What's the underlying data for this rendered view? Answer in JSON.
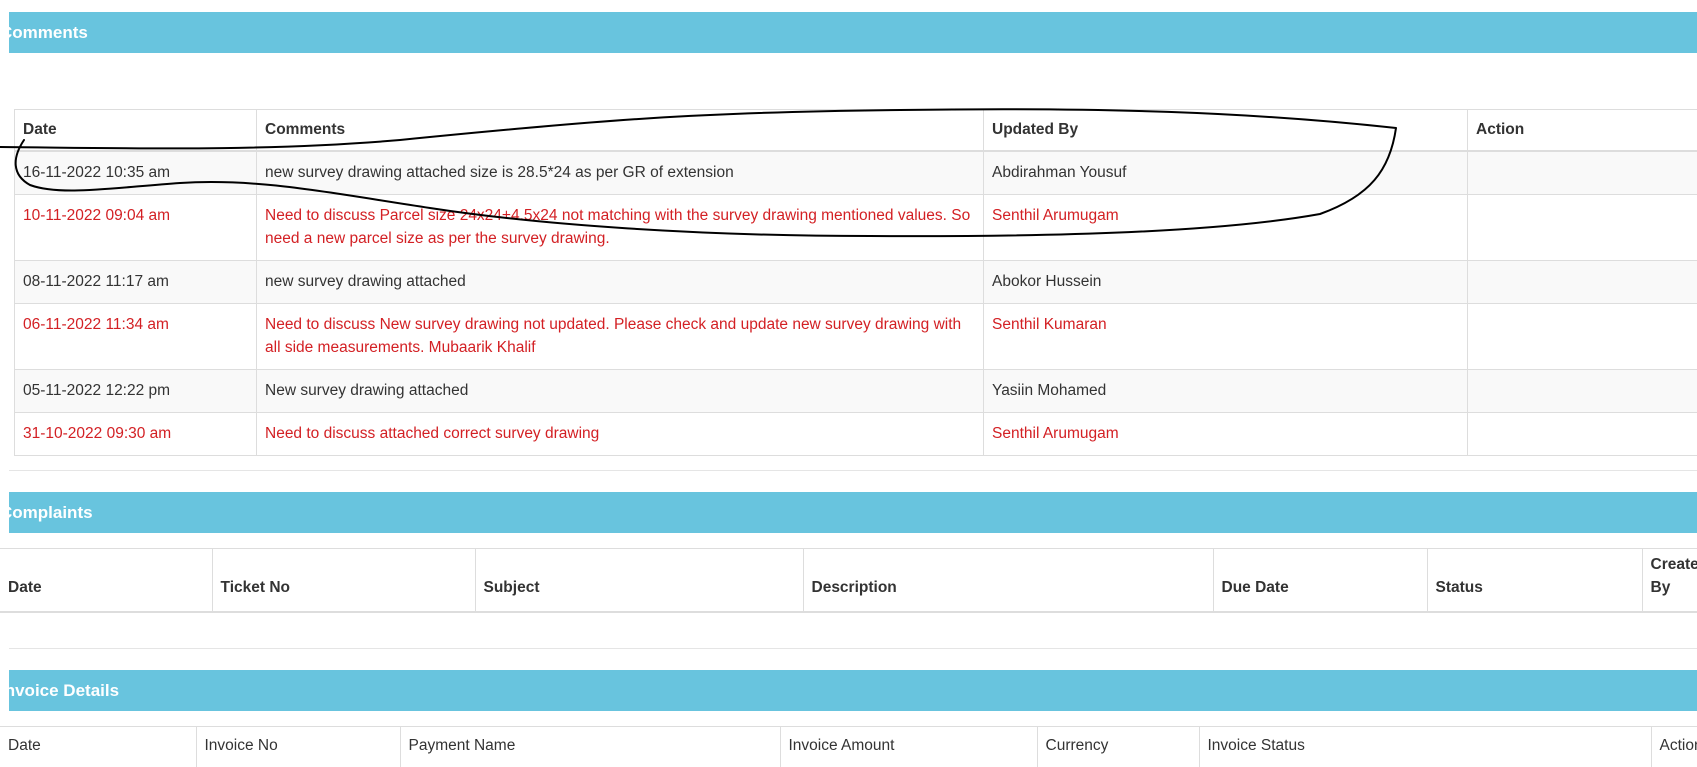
{
  "comments": {
    "title": "Comments",
    "headers": [
      "Date",
      "Comments",
      "Updated By",
      "Action"
    ],
    "rows": [
      {
        "date": "16-11-2022 10:35 am",
        "comment": "new survey drawing attached size is 28.5*24 as per GR of extension",
        "updated_by": "Abdirahman Yousuf",
        "action": "",
        "highlight": false
      },
      {
        "date": "10-11-2022 09:04 am",
        "comment": "Need to discuss Parcel size 24x24+4.5x24 not matching with the survey drawing mentioned values. So need a new parcel size as per the survey drawing.",
        "updated_by": "Senthil Arumugam",
        "action": "",
        "highlight": true
      },
      {
        "date": "08-11-2022 11:17 am",
        "comment": "new survey drawing attached",
        "updated_by": "Abokor Hussein",
        "action": "",
        "highlight": false
      },
      {
        "date": "06-11-2022 11:34 am",
        "comment": "Need to discuss New survey drawing not updated. Please check and update new survey drawing with all side measurements. Mubaarik Khalif",
        "updated_by": "Senthil Kumaran",
        "action": "",
        "highlight": true
      },
      {
        "date": "05-11-2022 12:22 pm",
        "comment": "New survey drawing attached",
        "updated_by": "Yasiin Mohamed",
        "action": "",
        "highlight": false
      },
      {
        "date": "31-10-2022 09:30 am",
        "comment": "Need to discuss attached correct survey drawing",
        "updated_by": "Senthil Arumugam",
        "action": "",
        "highlight": true
      }
    ]
  },
  "complaints": {
    "title": "Complaints",
    "headers": [
      "Date",
      "Ticket No",
      "Subject",
      "Description",
      "Due Date",
      "Status",
      "Created By"
    ]
  },
  "invoice": {
    "title": "Invoice Details",
    "headers": [
      "Date",
      "Invoice No",
      "Payment Name",
      "Invoice Amount",
      "Currency",
      "Invoice Status",
      "Action"
    ]
  },
  "colors": {
    "section_header_bg": "#68c4de",
    "highlight_text": "#d32024",
    "annotation_stroke": "#000000"
  }
}
